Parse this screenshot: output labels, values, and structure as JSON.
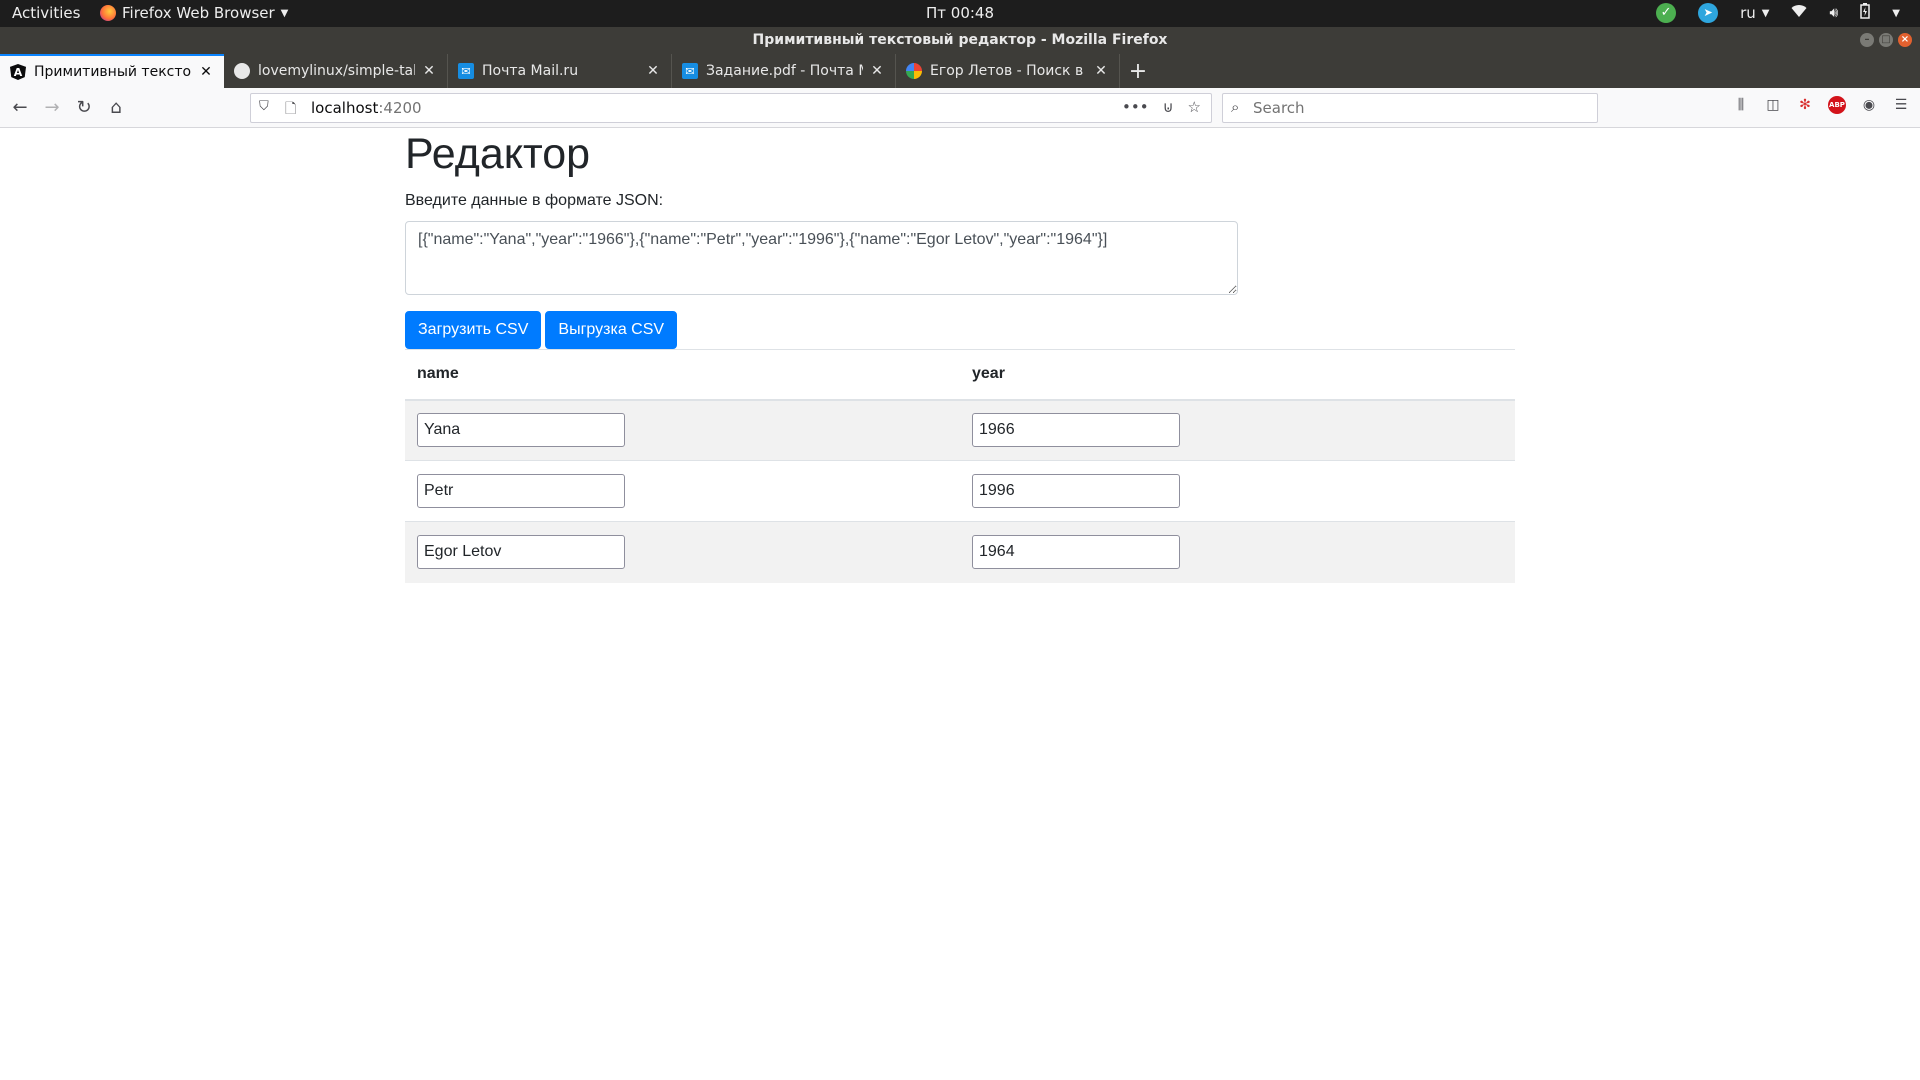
{
  "system_bar": {
    "activities": "Activities",
    "app_name": "Firefox Web Browser",
    "clock": "Пт 00:48",
    "language": "ru"
  },
  "window": {
    "title": "Примитивный текстовый редактор - Mozilla Firefox"
  },
  "tabs": [
    {
      "title": "Примитивный текстовый редактор",
      "icon": "angular-icon"
    },
    {
      "title": "lovemylinux/simple-table",
      "icon": "github-icon"
    },
    {
      "title": "Почта Mail.ru",
      "icon": "mail-icon"
    },
    {
      "title": "Задание.pdf - Почта Mail.ru",
      "icon": "mail-icon"
    },
    {
      "title": "Егор Летов - Поиск в Google",
      "icon": "google-icon"
    }
  ],
  "navbar": {
    "url_host": "localhost",
    "url_port": ":4200",
    "search_placeholder": "Search"
  },
  "page": {
    "title": "Редактор",
    "json_label": "Введите данные в формате JSON:",
    "json_value": "[{\"name\":\"Yana\",\"year\":\"1966\"},{\"name\":\"Petr\",\"year\":\"1996\"},{\"name\":\"Egor Letov\",\"year\":\"1964\"}]",
    "load_button": "Загрузить CSV",
    "export_button": "Выгрузка CSV",
    "table": {
      "columns": [
        "name",
        "year"
      ],
      "rows": [
        {
          "name": "Yana",
          "year": "1966"
        },
        {
          "name": "Petr",
          "year": "1996"
        },
        {
          "name": "Egor Letov",
          "year": "1964"
        }
      ]
    }
  },
  "colors": {
    "primary": "#007bff",
    "active_tab_accent": "#0a84ff",
    "tab_strip": "#3d3c38"
  }
}
